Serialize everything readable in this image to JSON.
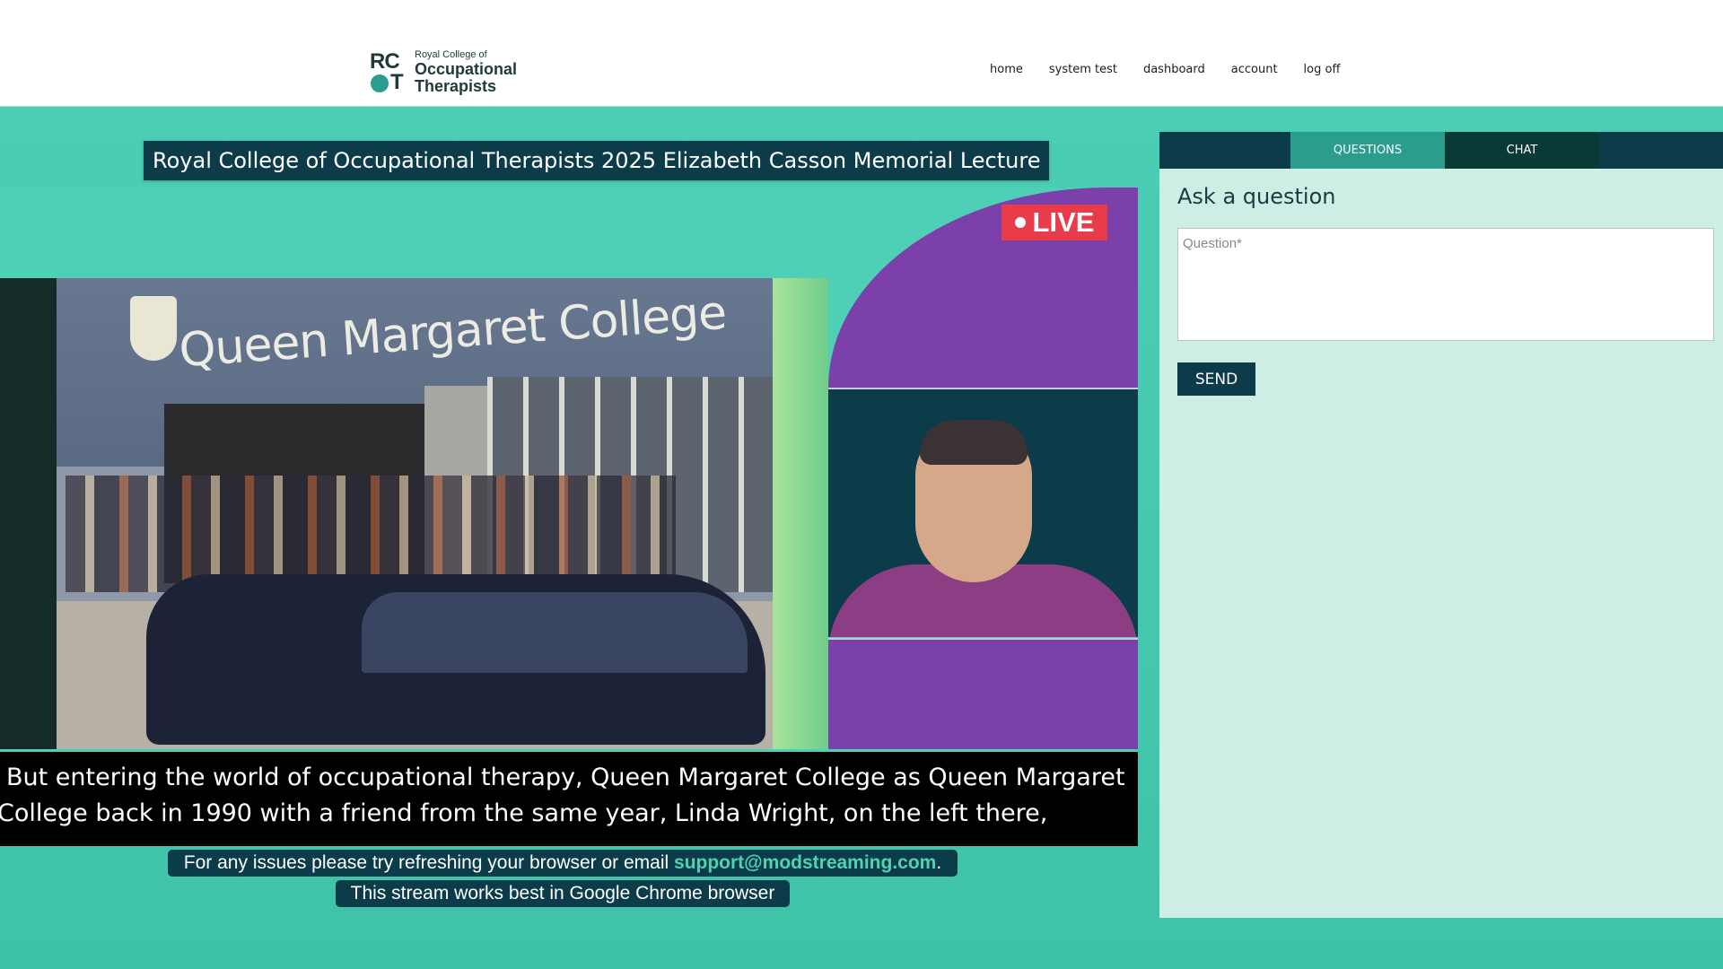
{
  "header": {
    "logo": {
      "mark_top": "RC",
      "mark_bottom": "T",
      "line1": "Royal College of",
      "line2": "Occupational",
      "line3": "Therapists"
    },
    "nav": [
      "home",
      "system test",
      "dashboard",
      "account",
      "log off"
    ]
  },
  "stream": {
    "title": "Royal College of Occupational Therapists 2025 Elizabeth Casson Memorial Lecture",
    "live_label": "LIVE",
    "slide_sign_text": "Queen Margaret College",
    "captions": [
      "But entering the world of occupational therapy, Queen Margaret College as Queen Margaret",
      "College back in 1990 with a friend from the same year, Linda Wright, on the left there,"
    ]
  },
  "notices": {
    "issues_prefix": "For any issues please try refreshing your browser or email ",
    "support_email": "support@modstreaming.com",
    "issues_suffix": ".",
    "browser_note": "This stream works best in Google Chrome browser"
  },
  "sidebar": {
    "tabs": [
      "QUESTIONS",
      "CHAT"
    ],
    "active_tab": "QUESTIONS",
    "heading": "Ask a question",
    "question_placeholder": "Question*",
    "send_label": "SEND"
  },
  "colors": {
    "navy": "#0c3c4a",
    "teal_bg": "#4dcfb5",
    "teal_tab": "#2a9d8f",
    "live_red": "#e83c4b",
    "purple": "#7b40aa",
    "panel_bg": "#cdeee5"
  }
}
